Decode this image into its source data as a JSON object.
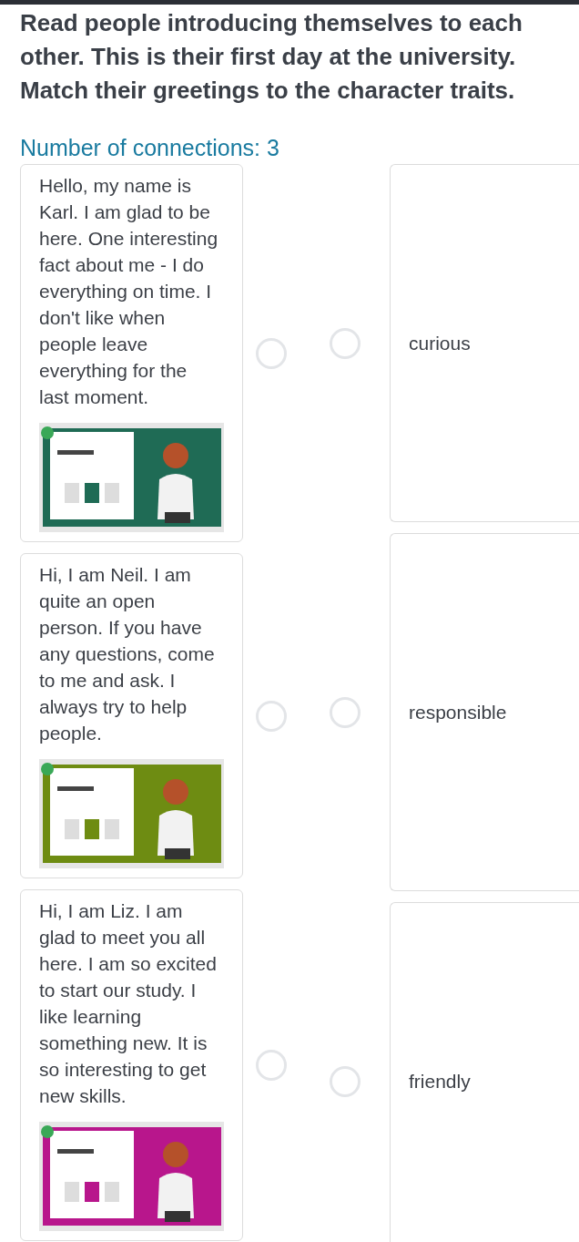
{
  "title": "Read people introducing themselves to each other. This is their first day at the university. Match their greetings to the character traits.",
  "connections_label": "Number of connections: 3",
  "greetings": [
    {
      "text": "Hello, my name is Karl. I am glad to be here. One interesting fact about me - I do everything on time. I don't like when people leave everything for the last moment."
    },
    {
      "text": "Hi, I am Neil. I am quite an open person. If you have any questions, come to me and ask. I always try to help people."
    },
    {
      "text": "Hi, I am Liz. I am glad to meet you all here. I am so excited to start our study. I like learning something new. It is so interesting to get new skills."
    }
  ],
  "traits": [
    {
      "label": "curious"
    },
    {
      "label": "responsible"
    },
    {
      "label": "friendly"
    }
  ]
}
